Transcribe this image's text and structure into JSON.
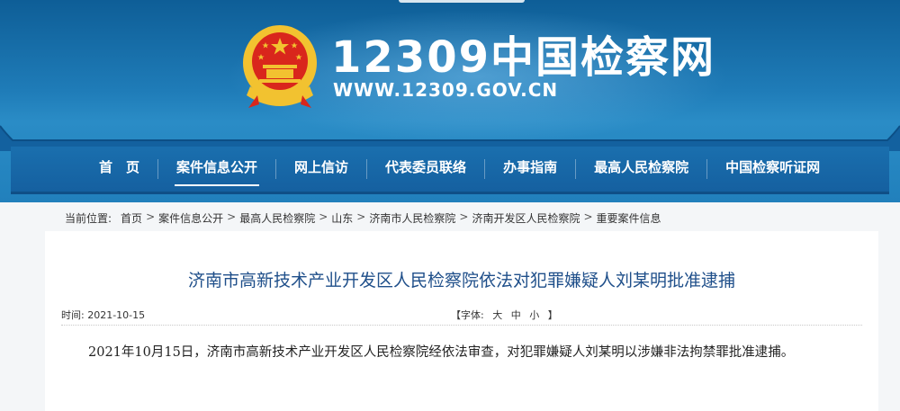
{
  "site": {
    "title": "12309中国检察网",
    "url": "WWW.12309.GOV.CN"
  },
  "nav": {
    "items": [
      {
        "label": "首　页",
        "active": false
      },
      {
        "label": "案件信息公开",
        "active": true
      },
      {
        "label": "网上信访",
        "active": false
      },
      {
        "label": "代表委员联络",
        "active": false
      },
      {
        "label": "办事指南",
        "active": false
      },
      {
        "label": "最高人民检察院",
        "active": false
      },
      {
        "label": "中国检察听证网",
        "active": false
      }
    ]
  },
  "breadcrumb": {
    "prefix": "当前位置:",
    "items": [
      "首页",
      "案件信息公开",
      "最高人民检察院",
      "山东",
      "济南市人民检察院",
      "济南开发区人民检察院",
      "重要案件信息"
    ]
  },
  "article": {
    "title": "济南市高新技术产业开发区人民检察院依法对犯罪嫌疑人刘某明批准逮捕",
    "date": "时间: 2021-10-15",
    "font_size_label": "【字体:",
    "font_sizes": [
      "大",
      "中",
      "小"
    ],
    "font_size_close": "】",
    "body": "2021年10月15日，济南市高新技术产业开发区人民检察院经依法审查，对犯罪嫌疑人刘某明以涉嫌非法拘禁罪批准逮捕。"
  },
  "colors": {
    "header_blue": "#1f7cb8",
    "nav_blue": "#1565a6",
    "title_blue": "#1f4f8a",
    "emblem_red": "#d9261c",
    "emblem_gold": "#f2c230"
  }
}
